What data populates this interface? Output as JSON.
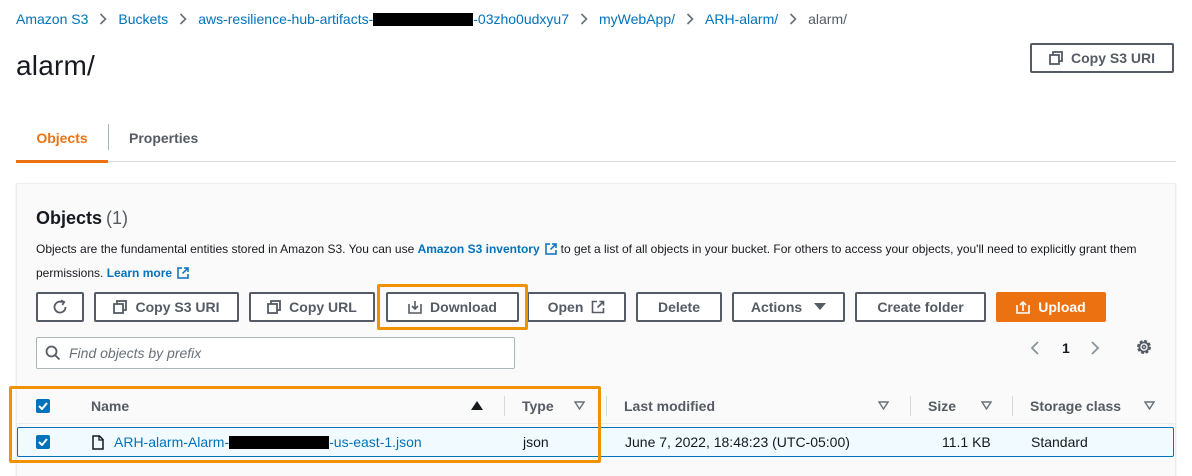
{
  "breadcrumb": {
    "items": [
      "Amazon S3",
      "Buckets",
      "aws-resilience-hub-artifacts-",
      "myWebApp/",
      "ARH-alarm/",
      "alarm/"
    ],
    "bucket_suffix": "-03zho0udxyu7"
  },
  "page": {
    "title": "alarm/",
    "copy_s3_uri_label": "Copy S3 URI"
  },
  "tabs": [
    {
      "label": "Objects",
      "active": true
    },
    {
      "label": "Properties",
      "active": false
    }
  ],
  "objects_panel": {
    "heading": "Objects",
    "count": "(1)",
    "description_1": "Objects are the fundamental entities stored in Amazon S3. You can use",
    "inventory_link": "Amazon S3 inventory",
    "description_2": "to get a list of all objects in your bucket. For others to access your objects, you'll need to explicitly grant them permissions.",
    "learn_more": "Learn more"
  },
  "toolbar": {
    "copy_s3_uri": "Copy S3 URI",
    "copy_url": "Copy URL",
    "download": "Download",
    "open": "Open",
    "delete": "Delete",
    "actions": "Actions",
    "create_folder": "Create folder",
    "upload": "Upload"
  },
  "search": {
    "placeholder": "Find objects by prefix"
  },
  "pagination": {
    "page": "1"
  },
  "table": {
    "headers": {
      "name": "Name",
      "type": "Type",
      "last_modified": "Last modified",
      "size": "Size",
      "storage_class": "Storage class"
    },
    "rows": [
      {
        "name_prefix": "ARH-alarm-Alarm-",
        "name_suffix": "-us-east-1.json",
        "type": "json",
        "last_modified": "June 7, 2022, 18:48:23 (UTC-05:00)",
        "size": "11.1 KB",
        "storage_class": "Standard",
        "selected": true
      }
    ]
  },
  "colors": {
    "accent": "#ec7211",
    "link": "#0073bb",
    "highlight": "#f29100",
    "text": "#16191f",
    "muted": "#545b64"
  }
}
